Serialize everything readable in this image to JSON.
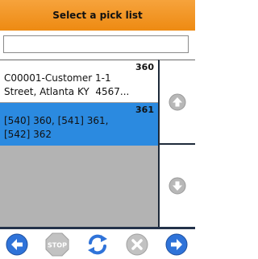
{
  "header": {
    "title": "Select a pick list"
  },
  "search": {
    "value": "",
    "placeholder": ""
  },
  "list": {
    "items": [
      {
        "number": "360",
        "text": "C00001-Customer 1-1\nStreet, Atlanta KY  4567...",
        "selected": false
      },
      {
        "number": "361",
        "text": "[540] 360, [541] 361,\n[542] 362",
        "selected": true
      }
    ]
  },
  "scroll": {
    "up_icon": "arrow-up-circle-icon",
    "down_icon": "arrow-down-circle-icon"
  },
  "toolbar": {
    "buttons": [
      {
        "icon": "arrow-left-icon",
        "enabled": true
      },
      {
        "icon": "stop-icon",
        "label": "STOP",
        "enabled": false
      },
      {
        "icon": "refresh-icon",
        "enabled": true
      },
      {
        "icon": "cancel-icon",
        "enabled": false
      },
      {
        "icon": "arrow-right-icon",
        "enabled": true
      }
    ]
  },
  "colors": {
    "header": "#f29a2a",
    "selected_row": "#2b8ae0",
    "toolbar_blue": "#2f73d9",
    "disabled_gray": "#b0b0b0"
  }
}
